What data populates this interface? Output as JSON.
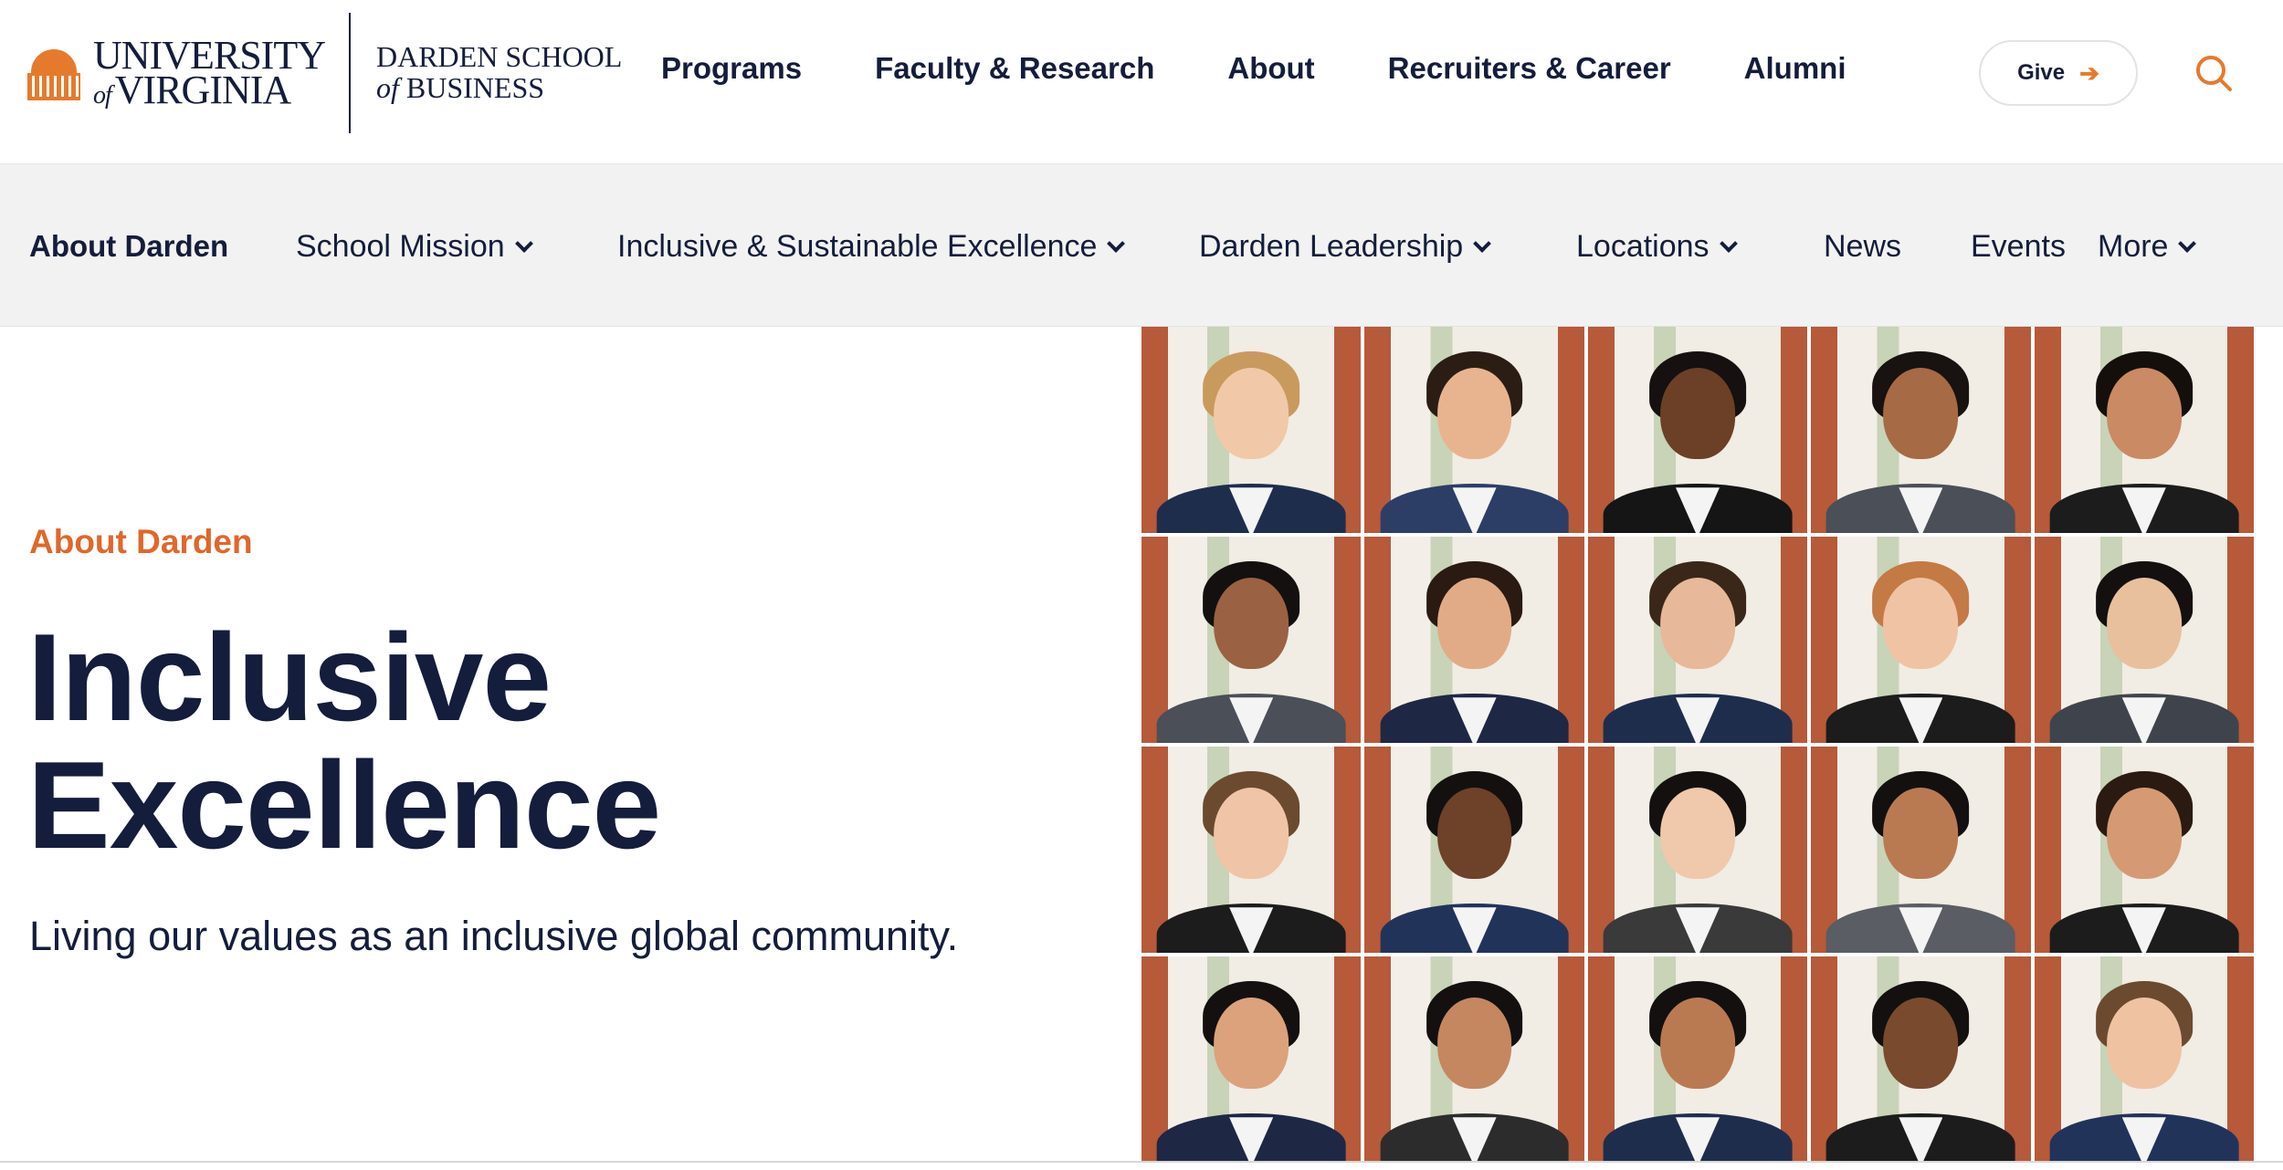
{
  "brand": {
    "university_line1": "UNIVERSITY",
    "university_of": "of",
    "university_line2": "VIRGINIA",
    "school_line1": "DARDEN SCHOOL",
    "school_of": "of",
    "school_line2": "BUSINESS",
    "accent_color": "#e57a2c",
    "navy_color": "#141d3b"
  },
  "main_nav": {
    "items": [
      {
        "label": "Programs"
      },
      {
        "label": "Faculty & Research"
      },
      {
        "label": "About"
      },
      {
        "label": "Recruiters & Career"
      },
      {
        "label": "Alumni"
      }
    ],
    "give_label": "Give",
    "give_icon": "arrow-right-icon",
    "search_icon": "search-icon"
  },
  "sub_nav": {
    "title": "About Darden",
    "items": [
      {
        "label": "School Mission",
        "has_dropdown": true
      },
      {
        "label": "Inclusive & Sustainable Excellence",
        "has_dropdown": true
      },
      {
        "label": "Darden Leadership",
        "has_dropdown": true
      },
      {
        "label": "Locations",
        "has_dropdown": true
      },
      {
        "label": "News",
        "has_dropdown": false
      },
      {
        "label": "Events",
        "has_dropdown": false
      },
      {
        "label": "More",
        "has_dropdown": true
      }
    ],
    "background": "#f2f2f2"
  },
  "hero": {
    "eyebrow": "About Darden",
    "title_line1": "Inclusive",
    "title_line2": "Excellence",
    "subtitle": "Living our values as an inclusive global community.",
    "eyebrow_color": "#e0672a"
  },
  "photo_grid": {
    "rows": 4,
    "columns": 5,
    "tiles": [
      {
        "skin": "#f1c9a8",
        "hair": "#c99a5e",
        "suit": "#1f2d4d"
      },
      {
        "skin": "#e8b48f",
        "hair": "#2b1d14",
        "suit": "#2c3e66"
      },
      {
        "skin": "#6b4026",
        "hair": "#161010",
        "suit": "#151515"
      },
      {
        "skin": "#a66a45",
        "hair": "#181210",
        "suit": "#4a4f58"
      },
      {
        "skin": "#c98a64",
        "hair": "#150f0c",
        "suit": "#1c1c1c"
      },
      {
        "skin": "#9a6242",
        "hair": "#141010",
        "suit": "#4a4f58"
      },
      {
        "skin": "#e2ab88",
        "hair": "#2a1a12",
        "suit": "#1e2744"
      },
      {
        "skin": "#e7b899",
        "hair": "#3a2719",
        "suit": "#1f2d4d"
      },
      {
        "skin": "#f0c3a4",
        "hair": "#c47a45",
        "suit": "#1c1c1c"
      },
      {
        "skin": "#e8c09d",
        "hair": "#141010",
        "suit": "#3f444c"
      },
      {
        "skin": "#f0c4a6",
        "hair": "#6b4a30",
        "suit": "#1c1c1c"
      },
      {
        "skin": "#6e4129",
        "hair": "#141010",
        "suit": "#22335a"
      },
      {
        "skin": "#f0c8ab",
        "hair": "#141010",
        "suit": "#3a3a3a"
      },
      {
        "skin": "#b97a52",
        "hair": "#141010",
        "suit": "#5a5d63"
      },
      {
        "skin": "#d59a74",
        "hair": "#2a1a12",
        "suit": "#1c1c1c"
      },
      {
        "skin": "#dba27c",
        "hair": "#141010",
        "suit": "#1e2744"
      },
      {
        "skin": "#c4875f",
        "hair": "#141010",
        "suit": "#2c2c2c"
      },
      {
        "skin": "#b97a52",
        "hair": "#141010",
        "suit": "#1f2d4d"
      },
      {
        "skin": "#7a4a2e",
        "hair": "#141010",
        "suit": "#1c1c1c"
      },
      {
        "skin": "#efc2a2",
        "hair": "#6b4a30",
        "suit": "#22335a"
      }
    ]
  }
}
